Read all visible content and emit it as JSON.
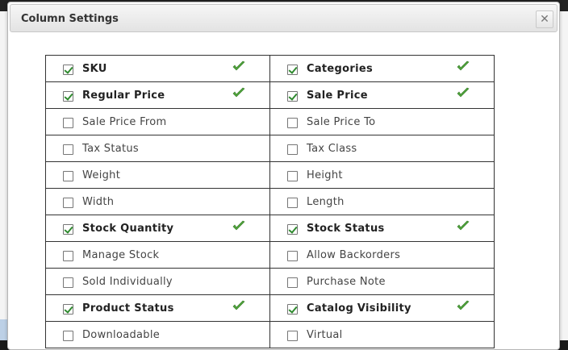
{
  "dialog": {
    "title": "Column Settings",
    "close_icon": "close-icon"
  },
  "colors": {
    "check": "#4ea43a",
    "border": "#333333"
  },
  "columns": [
    {
      "left": {
        "label": "SKU",
        "checked": true
      },
      "right": {
        "label": "Categories",
        "checked": true
      }
    },
    {
      "left": {
        "label": "Regular Price",
        "checked": true
      },
      "right": {
        "label": "Sale Price",
        "checked": true
      }
    },
    {
      "left": {
        "label": "Sale Price From",
        "checked": false
      },
      "right": {
        "label": "Sale Price To",
        "checked": false
      }
    },
    {
      "left": {
        "label": "Tax Status",
        "checked": false
      },
      "right": {
        "label": "Tax Class",
        "checked": false
      }
    },
    {
      "left": {
        "label": "Weight",
        "checked": false
      },
      "right": {
        "label": "Height",
        "checked": false
      }
    },
    {
      "left": {
        "label": "Width",
        "checked": false
      },
      "right": {
        "label": "Length",
        "checked": false
      }
    },
    {
      "left": {
        "label": "Stock Quantity",
        "checked": true
      },
      "right": {
        "label": "Stock Status",
        "checked": true
      }
    },
    {
      "left": {
        "label": "Manage Stock",
        "checked": false
      },
      "right": {
        "label": "Allow Backorders",
        "checked": false
      }
    },
    {
      "left": {
        "label": "Sold Individually",
        "checked": false
      },
      "right": {
        "label": "Purchase Note",
        "checked": false
      }
    },
    {
      "left": {
        "label": "Product Status",
        "checked": true
      },
      "right": {
        "label": "Catalog Visibility",
        "checked": true
      }
    },
    {
      "left": {
        "label": "Downloadable",
        "checked": false
      },
      "right": {
        "label": "Virtual",
        "checked": false
      }
    }
  ]
}
